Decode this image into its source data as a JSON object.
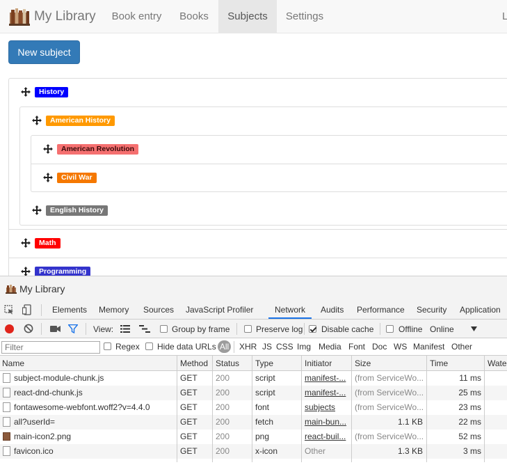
{
  "app": {
    "brand": "My Library",
    "nav": [
      {
        "label": "Book entry"
      },
      {
        "label": "Books"
      },
      {
        "label": "Subjects"
      },
      {
        "label": "Settings"
      }
    ],
    "nav_cut": "L",
    "new_subject_label": "New subject",
    "subjects": {
      "history": {
        "label": "History",
        "color": "#0000ff"
      },
      "american_history": {
        "label": "American History",
        "color": "#ff9900"
      },
      "american_revolution": {
        "label": "American Revolution",
        "color": "#f57070"
      },
      "civil_war": {
        "label": "Civil War",
        "color": "#f57800"
      },
      "english_history": {
        "label": "English History",
        "color": "#777777"
      },
      "math": {
        "label": "Math",
        "color": "#ff0000"
      },
      "programming": {
        "label": "Programming",
        "color": "#3333cc"
      }
    }
  },
  "devtools": {
    "title": "My Library",
    "tabs": [
      "Elements",
      "Memory",
      "Sources",
      "JavaScript Profiler",
      "Network",
      "Audits",
      "Performance",
      "Security",
      "Application"
    ],
    "active_tab": "Network",
    "toolbar": {
      "view_label": "View:",
      "group_by_frame": "Group by frame",
      "preserve_log": "Preserve log",
      "disable_cache": "Disable cache",
      "offline": "Offline",
      "throttle": "Online"
    },
    "filter": {
      "placeholder": "Filter",
      "regex": "Regex",
      "hide_data_urls": "Hide data URLs",
      "types": [
        "All",
        "XHR",
        "JS",
        "CSS",
        "Img",
        "Media",
        "Font",
        "Doc",
        "WS",
        "Manifest",
        "Other"
      ]
    },
    "columns": [
      "Name",
      "Method",
      "Status",
      "Type",
      "Initiator",
      "Size",
      "Time",
      "Wate"
    ],
    "rows": [
      {
        "name": "subject-module-chunk.js",
        "method": "GET",
        "status": "200",
        "type": "script",
        "initiator": "manifest-...",
        "size": "(from ServiceWo...",
        "time": "11 ms",
        "icon": "file"
      },
      {
        "name": "react-dnd-chunk.js",
        "method": "GET",
        "status": "200",
        "type": "script",
        "initiator": "manifest-...",
        "size": "(from ServiceWo...",
        "time": "25 ms",
        "icon": "file"
      },
      {
        "name": "fontawesome-webfont.woff2?v=4.4.0",
        "method": "GET",
        "status": "200",
        "type": "font",
        "initiator": "subjects",
        "size": "(from ServiceWo...",
        "time": "23 ms",
        "icon": "file"
      },
      {
        "name": "all?userId=",
        "method": "GET",
        "status": "200",
        "type": "fetch",
        "initiator": "main-bun...",
        "size": "1.1 KB",
        "time": "22 ms",
        "icon": "file"
      },
      {
        "name": "main-icon2.png",
        "method": "GET",
        "status": "200",
        "type": "png",
        "initiator": "react-buil...",
        "size": "(from ServiceWo...",
        "time": "52 ms",
        "icon": "image"
      },
      {
        "name": "favicon.ico",
        "method": "GET",
        "status": "200",
        "type": "x-icon",
        "initiator": "Other",
        "size": "1.3 KB",
        "time": "3 ms",
        "icon": "file"
      }
    ]
  }
}
